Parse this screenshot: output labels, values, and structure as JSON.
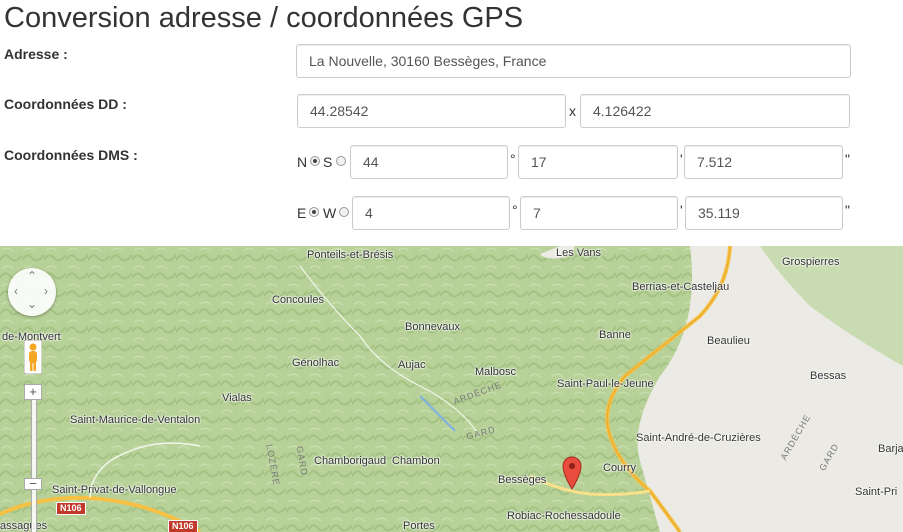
{
  "page": {
    "title": "Conversion adresse / coordonnées GPS"
  },
  "address": {
    "label": "Adresse :",
    "value": "La Nouvelle, 30160 Bessèges, France"
  },
  "dd": {
    "label": "Coordonnées DD :",
    "lat": "44.28542",
    "separator": "x",
    "lng": "4.126422"
  },
  "dms": {
    "label": "Coordonnées DMS :",
    "lat": {
      "hem1": "N",
      "hem2": "S",
      "selected": "N",
      "deg": "44",
      "min": "17",
      "sec": "7.512"
    },
    "lng": {
      "hem1": "E",
      "hem2": "W",
      "selected": "E",
      "deg": "4",
      "min": "7",
      "sec": "35.119"
    },
    "deg_symbol": "°",
    "min_symbol": "'",
    "sec_symbol": "\""
  },
  "map": {
    "places": [
      "Ponteils-et-Brésis",
      "Les Vans",
      "Grospierres",
      "Concoules",
      "Berrias-et-Casteljau",
      "Bonnevaux",
      "Banne",
      "Beaulieu",
      "de-Montvert",
      "Génolhac",
      "Aujac",
      "Malbosc",
      "Saint-Paul-le-Jeune",
      "Bessas",
      "Vialas",
      "Saint-Maurice-de-Ventalon",
      "Saint-André-de-Cruzières",
      "Barja",
      "Chamborigaud",
      "Chambon",
      "Courry",
      "Bessèges",
      "Saint-Privat-de-Vallongue",
      "Saint-Pri",
      "Robiac-Rochessadoule",
      "Portes",
      "assagues"
    ],
    "rivers": [
      "ARDÈCHE",
      "GARD",
      "LOZÈRE",
      "GARD",
      "ARDÈCHE",
      "GARD"
    ],
    "roads": [
      "N106",
      "N106"
    ],
    "colors": {
      "terrain": "#b9d39a",
      "lowland": "#ecebe6",
      "road": "#f6c044",
      "marker": "#e74c3c"
    },
    "controls": {
      "zoom_in": "+",
      "zoom_out": "−",
      "pan_up": "⌃",
      "pan_down": "⌄",
      "pan_left": "‹",
      "pan_right": "›"
    }
  }
}
